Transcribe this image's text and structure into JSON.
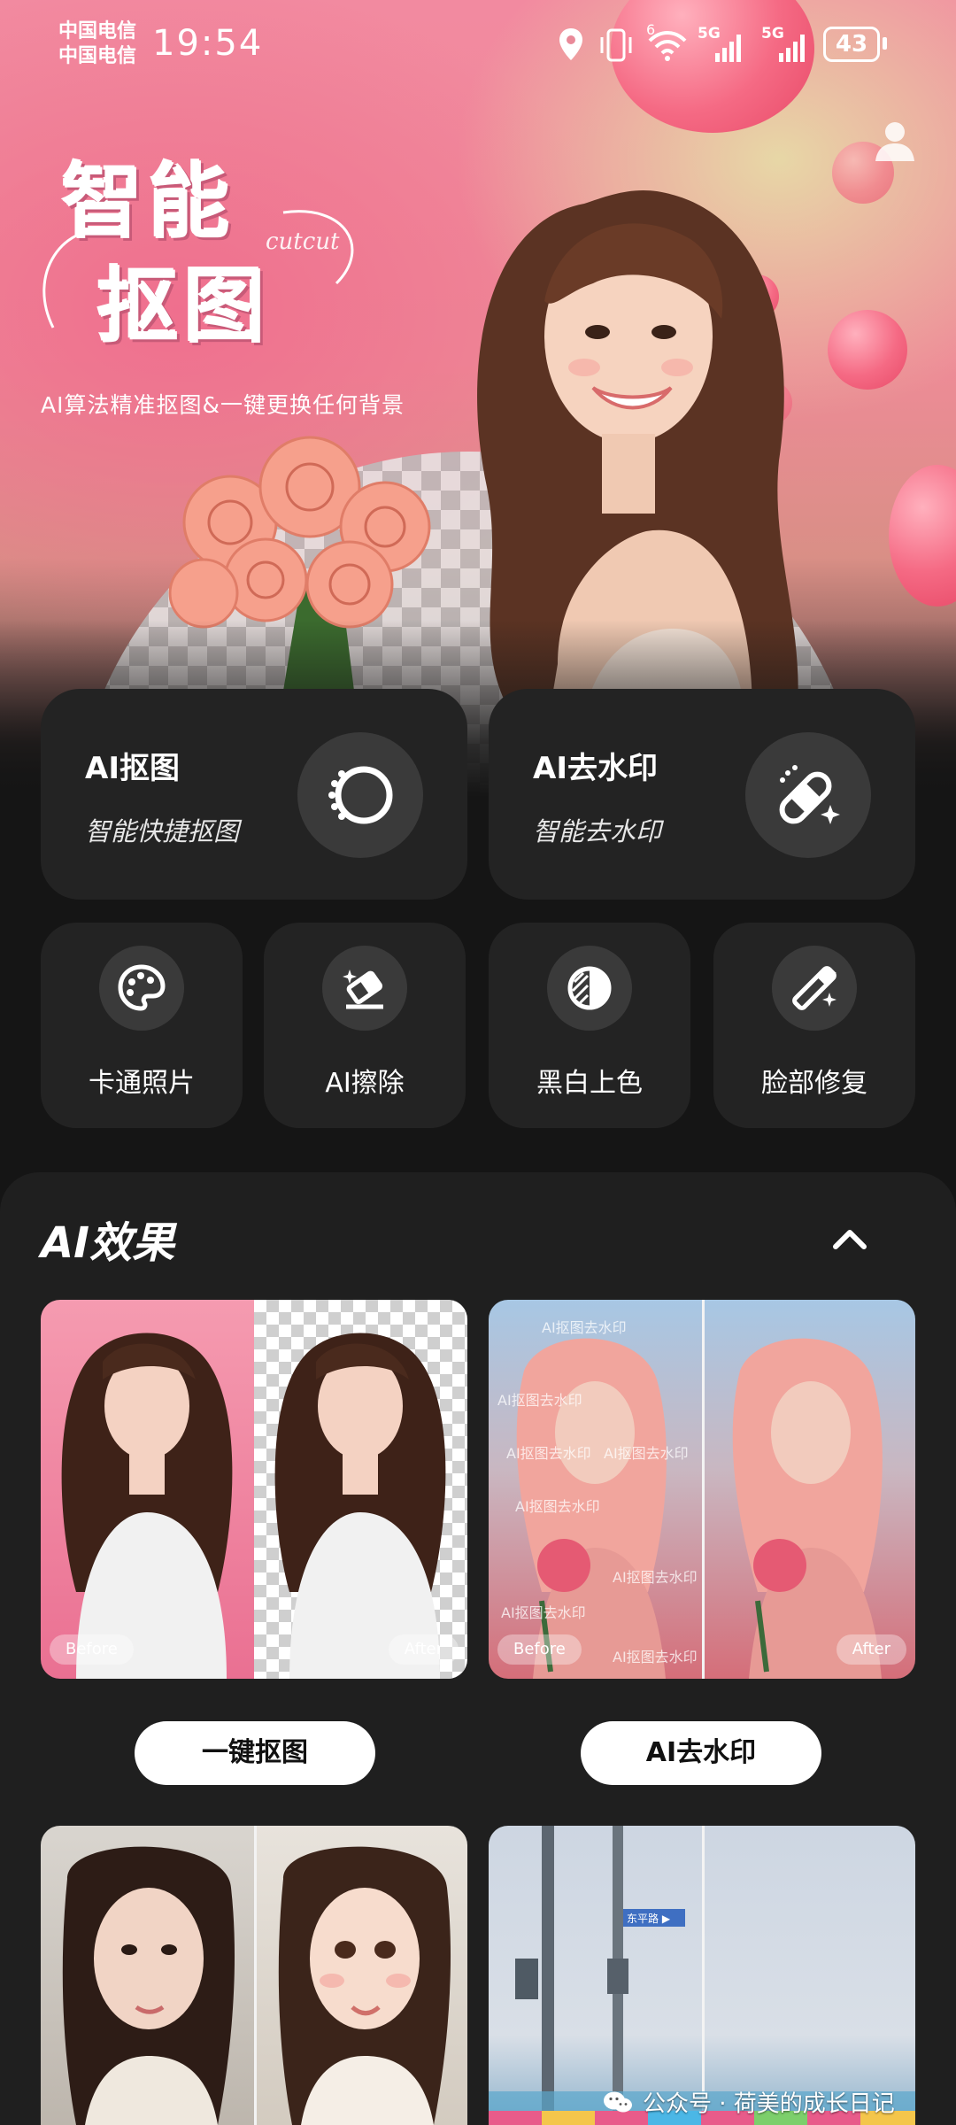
{
  "status_bar": {
    "carrier_1": "中国电信",
    "carrier_2": "中国电信",
    "time": "19:54",
    "network_1": "5G",
    "network_2": "5G",
    "wifi_badge": "6",
    "battery": "43"
  },
  "hero": {
    "title_line1": "智能",
    "title_line2": "抠图",
    "title_decoration": "cutcut",
    "subtitle": "AI算法精准抠图&一键更换任何背景"
  },
  "feature_cards": [
    {
      "title": "AI抠图",
      "subtitle": "智能快捷抠图",
      "icon": "cutout-circle-icon"
    },
    {
      "title": "AI去水印",
      "subtitle": "智能去水印",
      "icon": "bandage-sparkle-icon"
    }
  ],
  "tools": [
    {
      "label": "卡通照片",
      "icon": "palette-icon"
    },
    {
      "label": "AI擦除",
      "icon": "eraser-sparkle-icon"
    },
    {
      "label": "黑白上色",
      "icon": "half-tone-circle-icon"
    },
    {
      "label": "脸部修复",
      "icon": "magic-wand-icon"
    }
  ],
  "effects": {
    "title": "AI效果",
    "before_label": "Before",
    "after_label": "After",
    "watermark_text": "AI抠图去水印",
    "buttons": [
      "一键抠图",
      "AI去水印"
    ],
    "sign_text": "东平路 ▶"
  },
  "footer": {
    "credit": "公众号 · 荷美的成长日记"
  },
  "colors": {
    "background": "#151515",
    "card": "#232323",
    "panel": "#1f1f1f",
    "icon_circle": "#3a3a3a",
    "button": "#ffffff"
  }
}
